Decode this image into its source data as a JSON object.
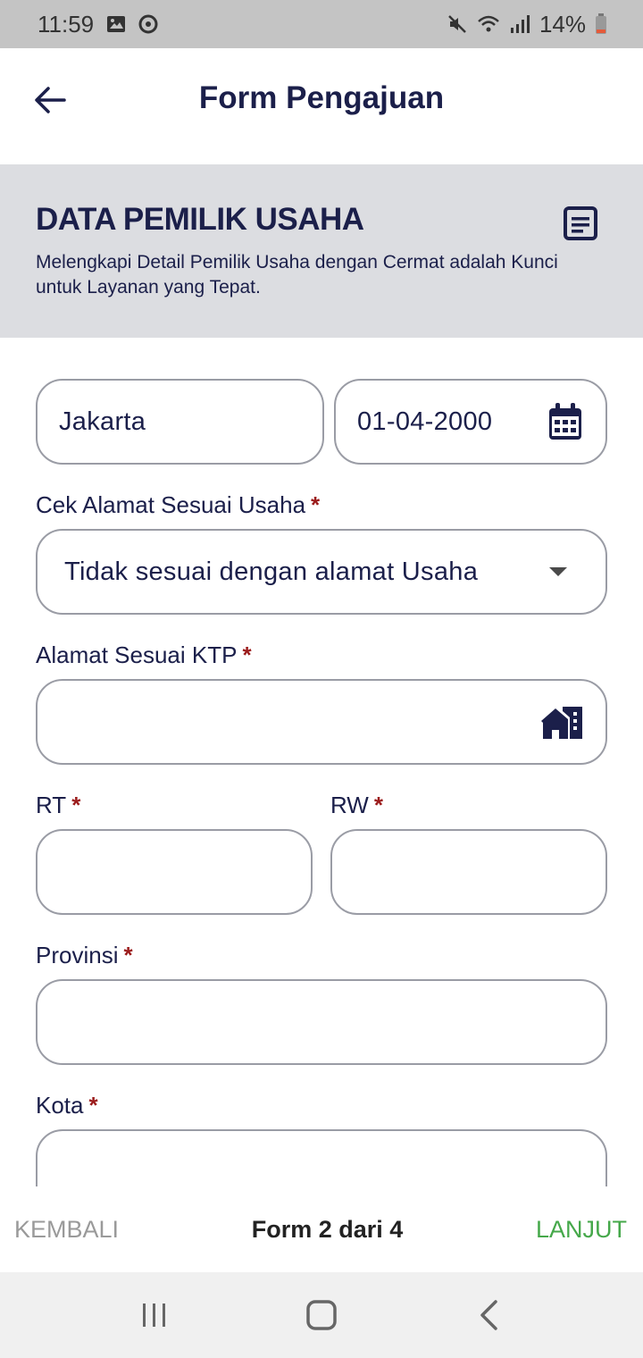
{
  "status_bar": {
    "time": "11:59",
    "battery": "14%",
    "icons": [
      "image-icon",
      "sync-icon",
      "mute-icon",
      "wifi-icon",
      "signal-icon",
      "battery-icon"
    ]
  },
  "header": {
    "title": "Form Pengajuan",
    "back_icon": "arrow-left-icon"
  },
  "section": {
    "title": "DATA PEMILIK USAHA",
    "description": "Melengkapi Detail Pemilik Usaha dengan Cermat adalah Kunci untuk Layanan yang Tepat.",
    "icon": "document-icon"
  },
  "form": {
    "birth_place": {
      "value": "Jakarta"
    },
    "birth_date": {
      "value": "01-04-2000",
      "icon": "calendar-icon"
    },
    "address_check": {
      "label": "Cek Alamat Sesuai Usaha",
      "required": "*",
      "value": "Tidak sesuai dengan alamat Usaha",
      "icon": "dropdown-arrow-icon"
    },
    "ktp_address": {
      "label": "Alamat Sesuai KTP",
      "required": "*",
      "value": "",
      "icon": "house-icon"
    },
    "rt": {
      "label": "RT",
      "required": "*",
      "value": ""
    },
    "rw": {
      "label": "RW",
      "required": "*",
      "value": ""
    },
    "province": {
      "label": "Provinsi",
      "required": "*",
      "value": ""
    },
    "city": {
      "label": "Kota",
      "required": "*",
      "value": ""
    }
  },
  "footer": {
    "back_label": "KEMBALI",
    "progress": "Form 2 dari 4",
    "next_label": "LANJUT"
  },
  "colors": {
    "primary_text": "#1b1f4a",
    "required": "#9b1b1b",
    "next": "#45a84a",
    "back": "#9a9a9a",
    "section_bg": "#dcdde1"
  }
}
